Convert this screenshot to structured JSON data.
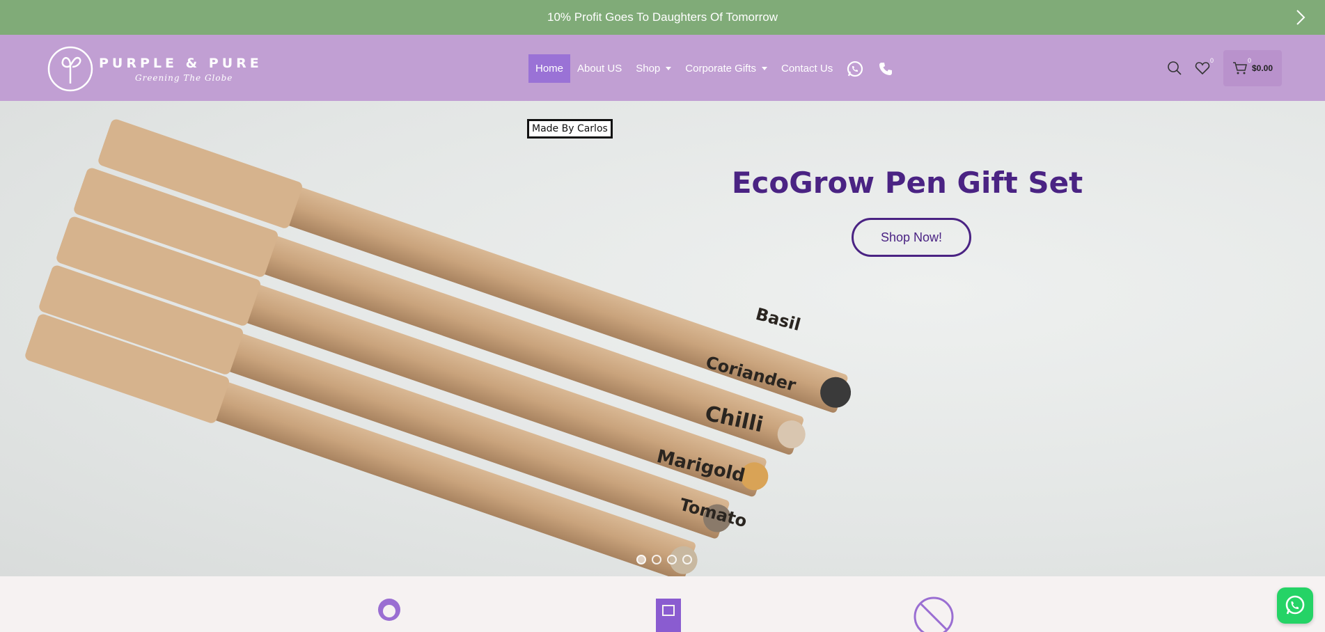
{
  "announcement": {
    "text": "10% Profit Goes To Daughters Of Tomorrow",
    "next_icon": "chevron-right-icon"
  },
  "logo": {
    "name": "PURPLE & PURE",
    "tagline": "Greening The Globe"
  },
  "nav": {
    "items": [
      {
        "label": "Home",
        "active": true
      },
      {
        "label": "About US"
      },
      {
        "label": "Shop",
        "has_dropdown": true
      },
      {
        "label": "Corporate Gifts",
        "has_dropdown": true
      },
      {
        "label": "Contact Us"
      }
    ],
    "icons": [
      "whatsapp-icon",
      "phone-icon"
    ]
  },
  "header_actions": {
    "wishlist_count": "0",
    "cart_count": "0",
    "cart_total": "$0.00"
  },
  "hero": {
    "badge": "Made By Carlos",
    "title": "EcoGrow Pen Gift Set",
    "cta": "Shop Now!",
    "pen_labels": [
      "Basil",
      "Coriander",
      "Chilli",
      "Marigold",
      "Tomato"
    ],
    "slide_count": 4,
    "active_slide": 1
  },
  "colors": {
    "announcement_bg": "#80ab78",
    "header_bg": "#c19fd3",
    "nav_active": "#9a72d6",
    "brand_purple": "#4a2383",
    "whatsapp": "#25d366"
  }
}
